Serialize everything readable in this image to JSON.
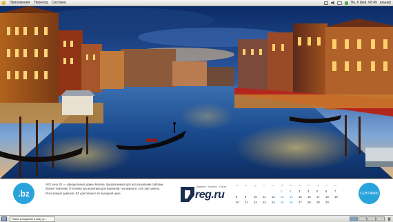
{
  "top_panel": {
    "menu": [
      "Приложения",
      "Переход",
      "Система"
    ],
    "clock": "Пн, 6 фев. 06:49",
    "user": "ильнур",
    "tray_icons": [
      "network-icon",
      "volume-icon",
      "mail-icon",
      "battery-icon"
    ]
  },
  "calendar": {
    "bz_logo": ".bz",
    "promo_text": "НЕ3 зона .bz — официальный домен Белиза, предлагаемый для использования сайтами бизнес-тематики. Отличная альтернатива для компаний, чьи имена в .com уже заняты. Регистрация доменов .BZ для бизнеса по выгодной цене.",
    "promo_highlight": ".BZ",
    "reg_tagline": "Домены · Хостинг · Почта",
    "reg_name": "reg.ru",
    "weekday_header": [
      "пн",
      "вт",
      "ср",
      "чт",
      "пт",
      "сб",
      "вс",
      "пн",
      "вт",
      "ср",
      "чт",
      "пт"
    ],
    "rows": [
      [
        "",
        "",
        "",
        "",
        "",
        "1",
        "2",
        "3",
        "4",
        "5",
        "6",
        "7"
      ],
      [
        "8",
        "9",
        "10",
        "11",
        "12",
        "13",
        "14",
        "15",
        "16",
        "17",
        "18",
        "19"
      ],
      [
        "20",
        "21",
        "22",
        "23",
        "24",
        "25",
        "26",
        "27",
        "28",
        "29",
        "30",
        ""
      ]
    ],
    "month_label": "СЕНТЯБРЬ"
  },
  "taskbar": {
    "window_title": "Новое вхождение в базу ус...",
    "workspaces": 4
  }
}
